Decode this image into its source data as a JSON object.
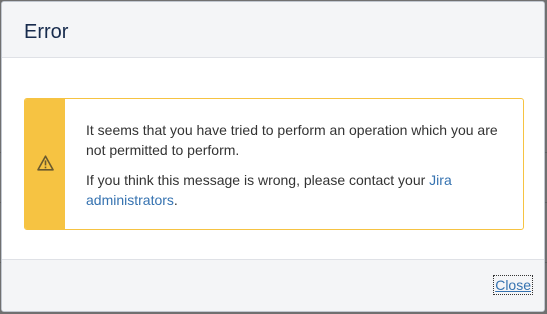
{
  "dialog": {
    "title": "Error",
    "message": {
      "line1": "It seems that you have tried to perform an operation which you are not permitted to perform.",
      "line2_prefix": "If you think this message is wrong, please contact your ",
      "line2_link": "Jira administrators",
      "line2_suffix": "."
    },
    "icon": "warning-icon",
    "close_label": "Close"
  },
  "colors": {
    "warning_accent": "#f6c342",
    "link": "#3572b0",
    "backdrop": "#707070"
  }
}
